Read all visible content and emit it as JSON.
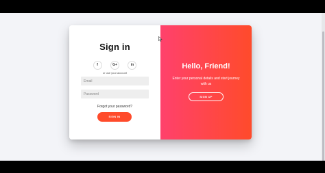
{
  "signin_panel": {
    "title": "Sign in",
    "social_icons": [
      {
        "icon": "facebook-icon",
        "glyph": "f"
      },
      {
        "icon": "google-plus-icon",
        "glyph": "G+"
      },
      {
        "icon": "linkedin-icon",
        "glyph": "in"
      }
    ],
    "hint_text": "or use your account",
    "email_placeholder": "Email",
    "email_value": "",
    "password_placeholder": "Password",
    "password_value": "",
    "forgot_link": "Forgot your password?",
    "signin_button": "SIGN IN"
  },
  "overlay_panel": {
    "title": "Hello, Friend!",
    "description": "Enter your personal details and start journey with us",
    "signup_button": "SIGN UP"
  },
  "colors": {
    "accent": "#ff4b2b",
    "gradient_start": "#ff416c",
    "gradient_end": "#ff4b2b",
    "page_background": "#f3f4f8"
  }
}
